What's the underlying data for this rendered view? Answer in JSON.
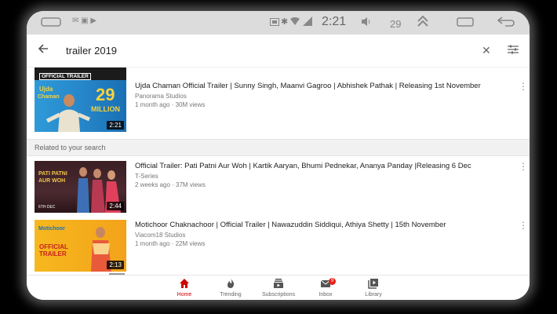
{
  "colors": {
    "accent": "#cc0000",
    "status_bar": "#dcdcdc",
    "section_bg": "#f1f1f1"
  },
  "status_bar": {
    "time": "2:21",
    "battery_level": "29",
    "icons": [
      "keyboard-icon",
      "notification-icons",
      "screenshot-icon",
      "bluetooth-icon",
      "wifi-icon",
      "signal-icon",
      "volume-icon",
      "battery-icon",
      "expand-icon",
      "window-icon",
      "back-icon"
    ]
  },
  "search": {
    "query": "trailer 2019"
  },
  "previous_result": {
    "thumb_tag": "OFFICIAL TRAILER"
  },
  "results": [
    {
      "title": "Ujda Chaman Official Trailer | Sunny Singh, Maanvi Gagroo | Abhishek Pathak | Releasing 1st November",
      "channel": "Panorama Studios",
      "meta": "1 month ago · 30M views",
      "duration": "2:21",
      "thumb_badge": "29",
      "thumb_badge_sub": "MILLION"
    }
  ],
  "section_label": "Related to your search",
  "related": [
    {
      "title": "Official Trailer: Pati Patni Aur Woh | Kartik Aaryan, Bhumi Pednekar, Ananya Panday |Releasing 6 Dec",
      "channel": "T-Series",
      "meta": "2 weeks ago · 37M views",
      "duration": "2:44"
    },
    {
      "title": "Motichoor Chaknachoor | Official Trailer | Nawazuddin Siddiqui, Athiya Shetty | 15th November",
      "channel": "Viacom18 Studios",
      "meta": "1 month ago · 22M views",
      "duration": "2:13",
      "thumb_text": "OFFICIAL TRAILER"
    }
  ],
  "nav": {
    "items": [
      {
        "label": "Home"
      },
      {
        "label": "Trending"
      },
      {
        "label": "Subscriptions"
      },
      {
        "label": "Inbox",
        "badge": "9"
      },
      {
        "label": "Library"
      }
    ]
  }
}
